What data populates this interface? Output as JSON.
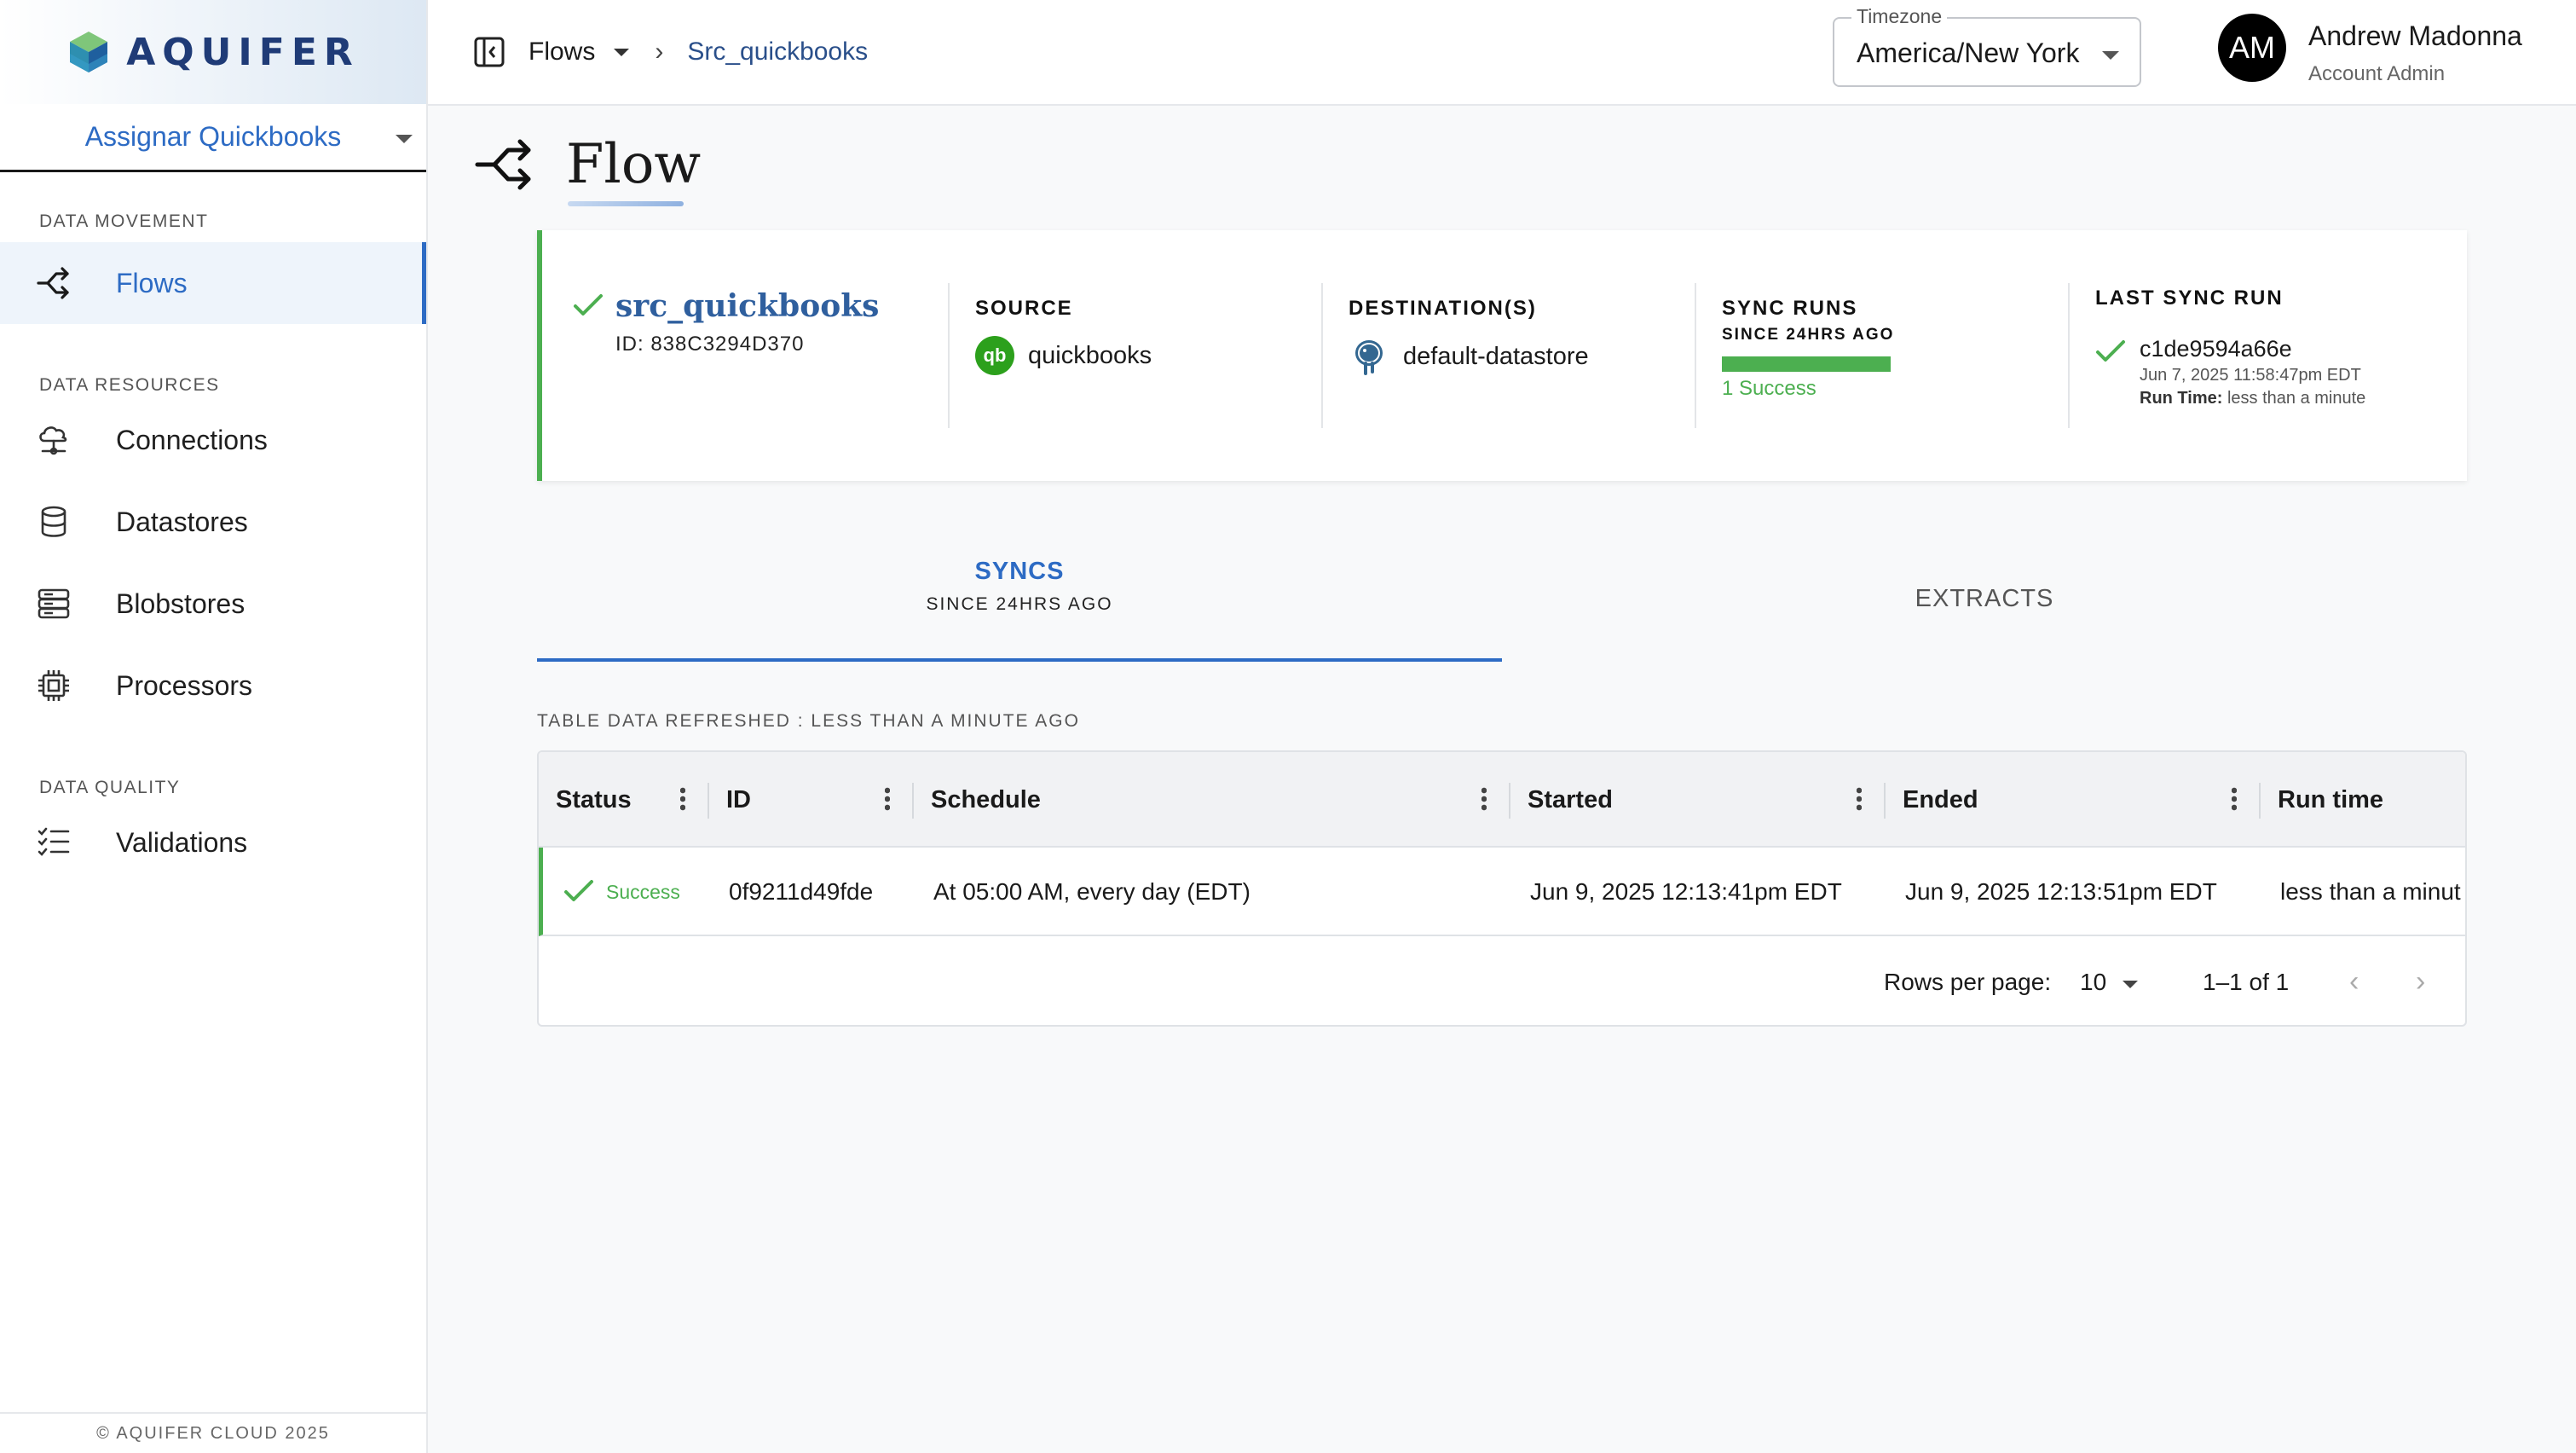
{
  "sidebar": {
    "logo_text": "AQUIFER",
    "project": "Assignar Quickbooks",
    "sections": [
      {
        "label": "DATA MOVEMENT"
      },
      {
        "label": "DATA RESOURCES"
      },
      {
        "label": "DATA QUALITY"
      }
    ],
    "items": [
      {
        "label": "Flows",
        "icon": "flows-icon",
        "active": true
      },
      {
        "label": "Connections",
        "icon": "cloud-connection-icon"
      },
      {
        "label": "Datastores",
        "icon": "database-icon"
      },
      {
        "label": "Blobstores",
        "icon": "server-stack-icon"
      },
      {
        "label": "Processors",
        "icon": "chip-icon"
      },
      {
        "label": "Validations",
        "icon": "checklist-icon"
      }
    ],
    "footer": "© AQUIFER CLOUD 2025"
  },
  "header": {
    "breadcrumb_root": "Flows",
    "breadcrumb_current": "Src_quickbooks",
    "timezone_label": "Timezone",
    "timezone_value": "America/New York",
    "user_initials": "AM",
    "user_name": "Andrew Madonna",
    "user_role": "Account Admin"
  },
  "page": {
    "title": "Flow"
  },
  "summary": {
    "flow_name": "src_quickbooks",
    "flow_id": "ID: 838C3294D370",
    "source_heading": "SOURCE",
    "source_name": "quickbooks",
    "source_logo": "qb",
    "destination_heading": "DESTINATION(S)",
    "destination_name": "default-datastore",
    "sync_runs_heading": "SYNC RUNS",
    "sync_runs_sub": "SINCE 24HRS AGO",
    "sync_success_fraction": 1.0,
    "sync_success_text": "1 Success",
    "last_run_heading": "LAST SYNC RUN",
    "last_run_id": "c1de9594a66e",
    "last_run_time": "Jun 7, 2025 11:58:47pm EDT",
    "last_run_duration_label": "Run Time:",
    "last_run_duration": "less than a minute"
  },
  "tabs": [
    {
      "label": "SYNCS",
      "sub": "SINCE 24HRS AGO",
      "active": true
    },
    {
      "label": "EXTRACTS",
      "active": false
    }
  ],
  "table": {
    "refreshed_text": "TABLE DATA REFRESHED : LESS THAN A MINUTE AGO",
    "columns": [
      "Status",
      "ID",
      "Schedule",
      "Started",
      "Ended",
      "Run time"
    ],
    "rows": [
      {
        "status": "Success",
        "id": "0f9211d49fde",
        "schedule": "At 05:00 AM, every day (EDT)",
        "started": "Jun 9, 2025 12:13:41pm EDT",
        "ended": "Jun 9, 2025 12:13:51pm EDT",
        "run_time": "less than a minut"
      }
    ],
    "rows_per_page_label": "Rows per page:",
    "rows_per_page_value": "10",
    "range_text": "1–1 of 1"
  },
  "colors": {
    "accent": "#2d6bc4",
    "success": "#4caf50",
    "brand_text": "#1f3b77"
  }
}
